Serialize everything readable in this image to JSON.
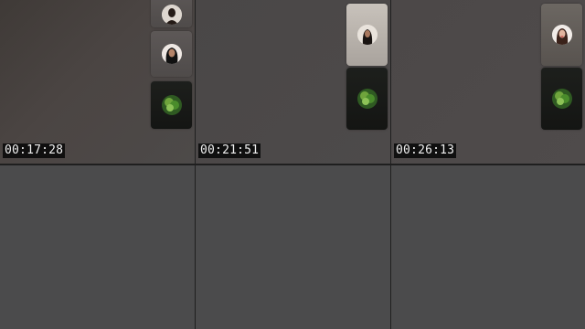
{
  "frames": [
    {
      "timestamp": "00:17:28"
    },
    {
      "timestamp": "00:21:51"
    },
    {
      "timestamp": "00:26:13"
    }
  ],
  "icons": {
    "participant_avatar": "avatar-icon",
    "leaf_emblem": "leaf-emblem-icon"
  }
}
